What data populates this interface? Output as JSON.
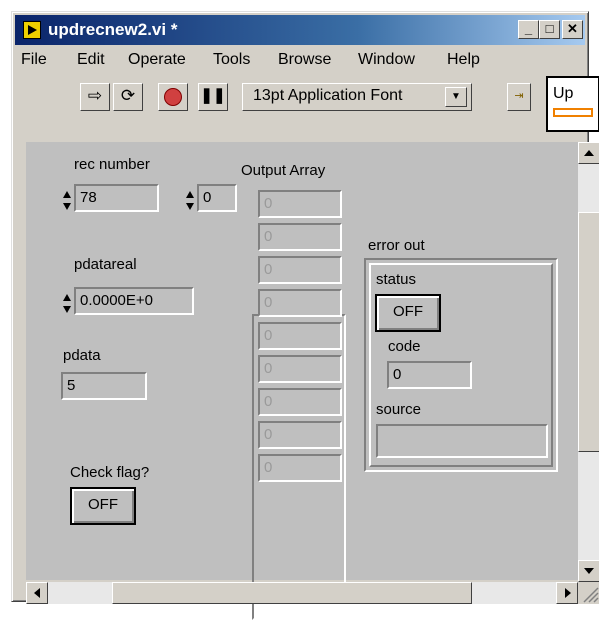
{
  "window": {
    "title": "updrecnew2.vi *",
    "minimize": "_",
    "maximize": "□",
    "close": "✕"
  },
  "menu": [
    "File",
    "Edit",
    "Operate",
    "Tools",
    "Browse",
    "Window",
    "Help"
  ],
  "toolbar": {
    "font_select": "13pt Application Font",
    "run_icon": "run-arrow-icon",
    "run_cont_icon": "run-continuously-icon",
    "abort_icon": "abort-icon",
    "pause_icon": "pause-icon"
  },
  "vi_icon_text": "Up",
  "panel": {
    "rec_number": {
      "label": "rec number",
      "value": "78"
    },
    "index": {
      "value": "0"
    },
    "output_array": {
      "label": "Output Array",
      "items": [
        "0",
        "0",
        "0",
        "0",
        "0",
        "0",
        "0",
        "0",
        "0"
      ]
    },
    "pdatareal": {
      "label": "pdatareal",
      "value": "0.0000E+0"
    },
    "pdata": {
      "label": "pdata",
      "value": "5"
    },
    "check_flag": {
      "label": "Check flag?",
      "button": "OFF"
    },
    "error_out": {
      "label": "error out",
      "status_label": "status",
      "status_value": "OFF",
      "code_label": "code",
      "code_value": "0",
      "source_label": "source",
      "source_value": ""
    }
  }
}
